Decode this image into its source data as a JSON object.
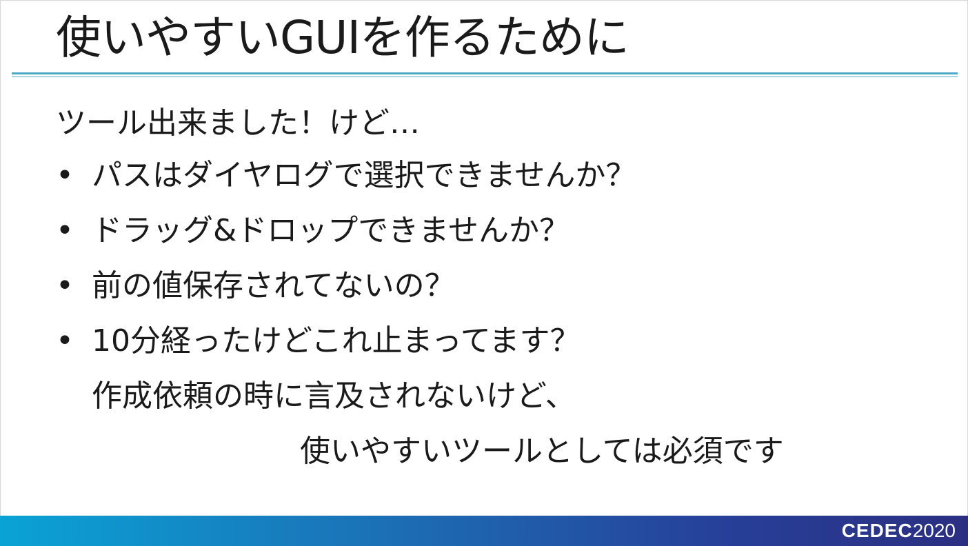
{
  "slide": {
    "title": "使いやすいGUIを作るために",
    "intro": "ツール出来ました！けど…",
    "bullet_symbol": "•",
    "bullets": [
      "パスはダイヤログで選択できませんか？",
      "ドラッグ&ドロップできませんか？",
      "前の値保存されてないの？",
      "10分経ったけどこれ止まってます？"
    ],
    "note_line1": "作成依頼の時に言及されないけど、",
    "note_line2": "使いやすいツールとしては必須です"
  },
  "footer": {
    "logo_word": "CEDEC",
    "logo_year": "2020"
  },
  "colors": {
    "rule": "#4aa9c7",
    "footer_start": "#0aa3d6",
    "footer_end": "#2b2f82"
  }
}
